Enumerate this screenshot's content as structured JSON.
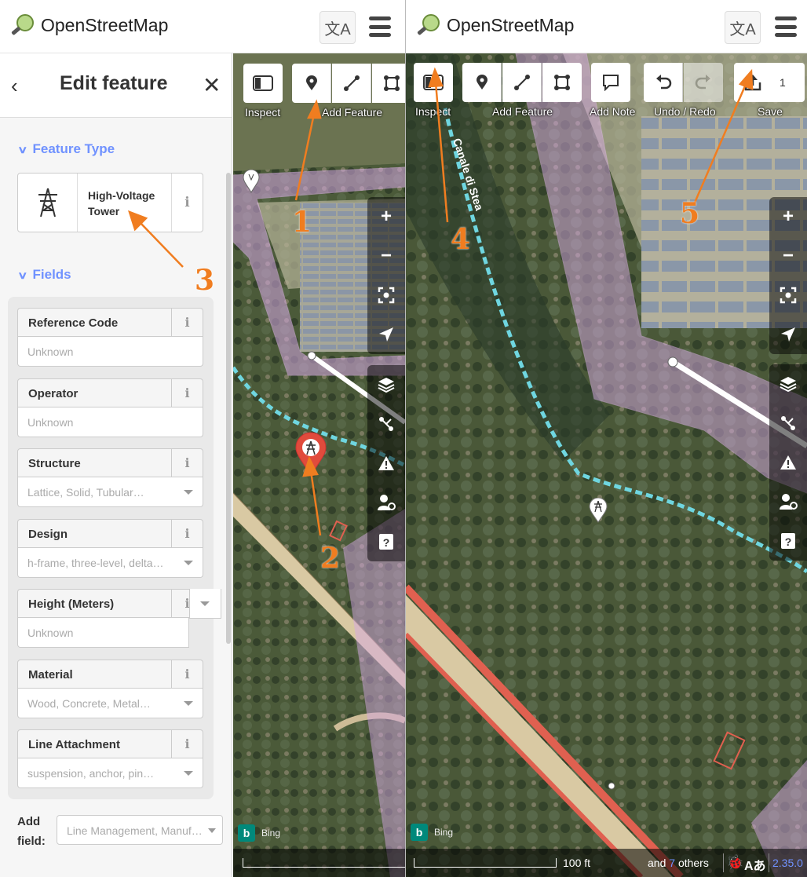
{
  "app": {
    "name": "OpenStreetMap"
  },
  "sidebar": {
    "title": "Edit feature",
    "back_icon": "‹",
    "close_icon": "✕",
    "feature_type": {
      "section_label": "Feature Type",
      "preset_name": "High-Voltage Tower",
      "info": "i"
    },
    "fields": {
      "section_label": "Fields",
      "items": [
        {
          "label": "Reference Code",
          "placeholder": "Unknown",
          "dropdown": false
        },
        {
          "label": "Operator",
          "placeholder": "Unknown",
          "dropdown": false
        },
        {
          "label": "Structure",
          "placeholder": "Lattice, Solid, Tubular…",
          "dropdown": true
        },
        {
          "label": "Design",
          "placeholder": "h-frame, three-level, delta…",
          "dropdown": true
        },
        {
          "label": "Height (Meters)",
          "placeholder": "Unknown",
          "dropdown": false
        },
        {
          "label": "Material",
          "placeholder": "Wood, Concrete, Metal…",
          "dropdown": true
        },
        {
          "label": "Line Attachment",
          "placeholder": "suspension, anchor, pin…",
          "dropdown": true
        }
      ]
    },
    "add_field": {
      "label": "Add field:",
      "placeholder": "Line Management, Manuf…"
    }
  },
  "toolbar": {
    "inspect": "Inspect",
    "add_feature": "Add Feature",
    "add_note": "Add Note",
    "undo_redo": "Undo / Redo",
    "save": "Save",
    "save_count": "1"
  },
  "map": {
    "imagery": "Bing",
    "scale_label": "100 ft",
    "attribution_prefix": "and",
    "attribution_count": "7",
    "attribution_suffix": "others",
    "version": "2.35.0",
    "waterway_label": "Canale di Stea"
  },
  "annotations": [
    "1",
    "2",
    "3",
    "4",
    "5"
  ],
  "colors": {
    "accent": "#7092ff",
    "arrow": "#f07d20",
    "waterway": "#6fd6e0",
    "landuse": "#d6a8e4",
    "road": "#e06050"
  }
}
